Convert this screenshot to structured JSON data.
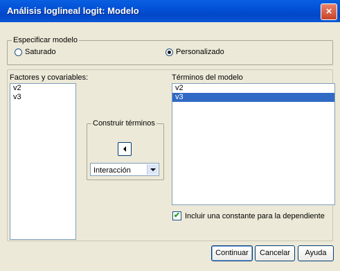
{
  "window": {
    "title": "Análisis loglineal logit: Modelo",
    "close_glyph": "×"
  },
  "specify_model": {
    "legend": "Especificar modelo",
    "options": [
      {
        "label": "Saturado",
        "selected": false
      },
      {
        "label": "Personalizado",
        "selected": true
      }
    ]
  },
  "factors": {
    "label": "Factores y covariables:",
    "items": [
      "v2",
      "v3"
    ]
  },
  "build_terms": {
    "legend": "Construir términos",
    "type_value": "Interacción"
  },
  "model_terms": {
    "label": "Términos del modelo",
    "items": [
      {
        "text": "v2",
        "selected": false
      },
      {
        "text": "v3",
        "selected": true
      }
    ]
  },
  "include_constant": {
    "label": "Incluir una constante para la dependiente",
    "checked": true,
    "check_glyph": "✔"
  },
  "buttons": {
    "continue": "Continuar",
    "cancel": "Cancelar",
    "help": "Ayuda"
  }
}
